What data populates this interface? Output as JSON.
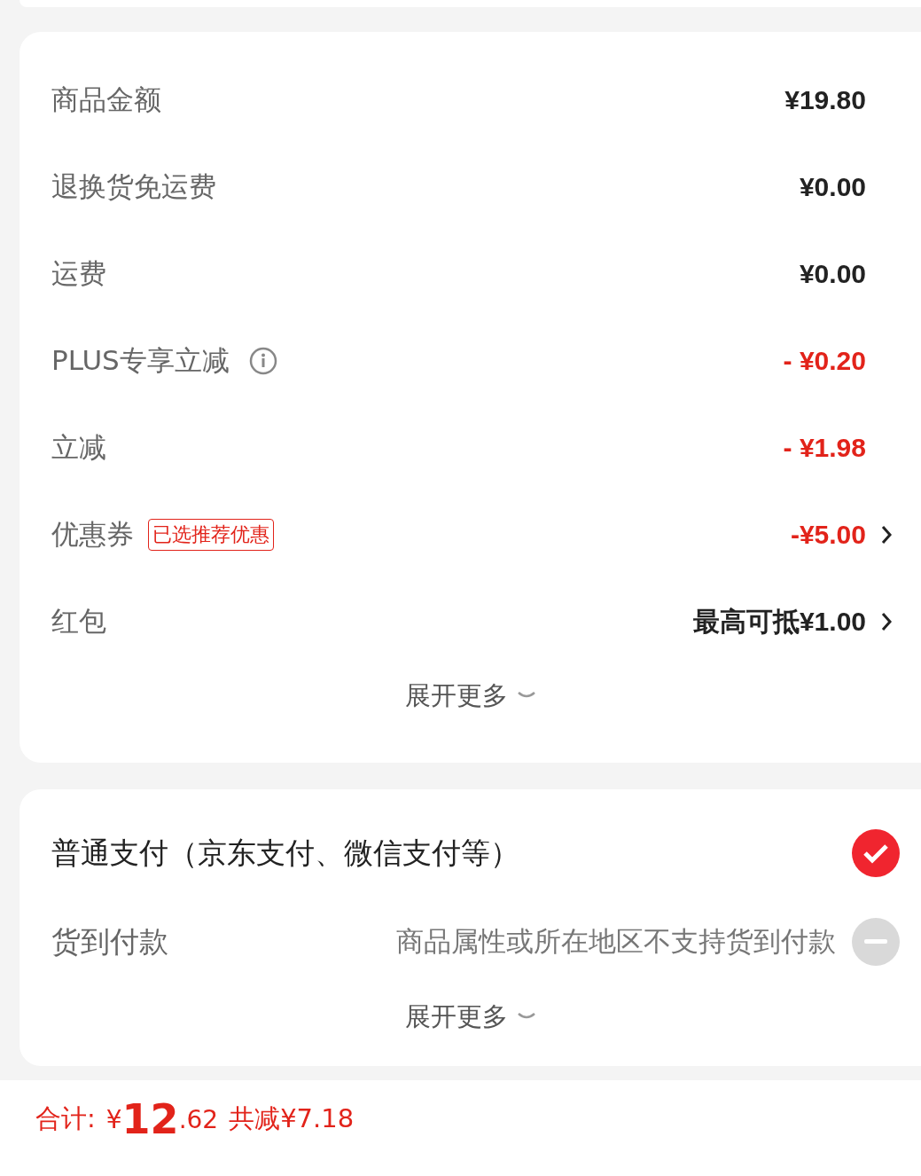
{
  "price_details": {
    "rows": [
      {
        "label": "商品金额",
        "kind": "amount",
        "value": "¥19.80",
        "info": false,
        "chevron": false
      },
      {
        "label": "退换货免运费",
        "kind": "amount",
        "value": "¥0.00",
        "info": false,
        "chevron": false
      },
      {
        "label": "运费",
        "kind": "amount",
        "value": "¥0.00",
        "info": false,
        "chevron": false
      },
      {
        "label": "PLUS专享立减",
        "kind": "discount",
        "value": "- ¥0.20",
        "info": true,
        "chevron": false
      },
      {
        "label": "立减",
        "kind": "discount",
        "value": "- ¥1.98",
        "info": false,
        "chevron": false
      },
      {
        "label": "优惠券",
        "tag": "已选推荐优惠",
        "kind": "discount",
        "value": "-¥5.00",
        "info": false,
        "chevron": true
      },
      {
        "label": "红包",
        "kind": "amount",
        "value": "最高可抵¥1.00",
        "info": false,
        "chevron": true
      }
    ],
    "expand": "展开更多"
  },
  "payment": {
    "options": [
      {
        "label": "普通支付（京东支付、微信支付等）",
        "available": true,
        "selected": true
      },
      {
        "label": "货到付款",
        "note": "商品属性或所在地区不支持货到付款",
        "available": false,
        "selected": false
      }
    ],
    "expand": "展开更多"
  },
  "footer": {
    "label": "合计:",
    "currency": "¥",
    "integer": "12",
    "decimal": ".62",
    "saving": "共减¥7.18"
  }
}
